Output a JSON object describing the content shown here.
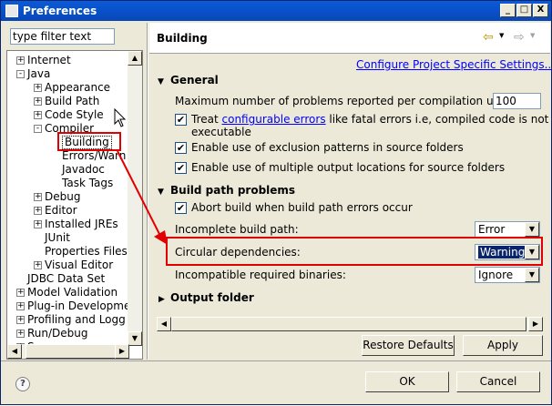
{
  "window": {
    "title": "Preferences",
    "minimize": "_",
    "maximize": "□",
    "close": "X"
  },
  "filter": {
    "value": "type filter text"
  },
  "tree": [
    {
      "label": "Internet",
      "expander": "+"
    },
    {
      "label": "Java",
      "expander": "−"
    },
    {
      "label": "Appearance",
      "expander": "+"
    },
    {
      "label": "Build Path",
      "expander": "+"
    },
    {
      "label": "Code Style",
      "expander": "+"
    },
    {
      "label": "Compiler",
      "expander": "−"
    },
    {
      "label": "Building",
      "expander": ""
    },
    {
      "label": "Errors/Warn",
      "expander": ""
    },
    {
      "label": "Javadoc",
      "expander": ""
    },
    {
      "label": "Task Tags",
      "expander": ""
    },
    {
      "label": "Debug",
      "expander": "+"
    },
    {
      "label": "Editor",
      "expander": "+"
    },
    {
      "label": "Installed JREs",
      "expander": "+"
    },
    {
      "label": "JUnit",
      "expander": ""
    },
    {
      "label": "Properties Files",
      "expander": ""
    },
    {
      "label": "Visual Editor",
      "expander": "+"
    },
    {
      "label": "JDBC Data Set",
      "expander": ""
    },
    {
      "label": "Model Validation",
      "expander": "+"
    },
    {
      "label": "Plug-in Developme",
      "expander": "+"
    },
    {
      "label": "Profiling and Logg",
      "expander": "+"
    },
    {
      "label": "Run/Debug",
      "expander": "+"
    },
    {
      "label": "Server",
      "expander": "+"
    }
  ],
  "page": {
    "title": "Building",
    "back": "⇦",
    "forward": "⇨",
    "link": "Configure Project Specific Settings..."
  },
  "general": {
    "header": "General",
    "max_label": "Maximum number of problems reported per compilation unit:",
    "max_value": "100",
    "treat_pre": "Treat ",
    "treat_link": "configurable errors",
    "treat_post": " like fatal errors i.e, compiled code is not",
    "treat_line2": "executable",
    "exclusion": "Enable use of exclusion patterns in source folders",
    "multiple": "Enable use of multiple output locations for source folders",
    "check": "✔"
  },
  "build": {
    "header": "Build path problems",
    "abort": "Abort build when build path errors occur",
    "incomplete_label": "Incomplete build path:",
    "incomplete_value": "Error",
    "circular_label": "Circular dependencies:",
    "circular_value": "Warning",
    "incompatible_label": "Incompatible required binaries:",
    "incompatible_value": "Ignore"
  },
  "output": {
    "header": "Output folder"
  },
  "buttons": {
    "restore": "Restore Defaults",
    "apply": "Apply",
    "ok": "OK",
    "cancel": "Cancel",
    "help": "?"
  }
}
